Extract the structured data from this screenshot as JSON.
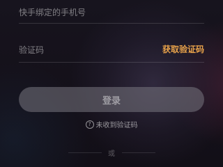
{
  "login_form": {
    "phone_placeholder": "快手绑定的手机号",
    "code_placeholder": "验证码",
    "get_code_label": "获取验证码",
    "login_label": "登录",
    "not_received_label": "未收到验证码",
    "help_icon_glyph": "?",
    "divider_text": "或"
  },
  "colors": {
    "accent": "#e8a24a",
    "button_disabled": "#78767f",
    "background": "#15121d"
  }
}
